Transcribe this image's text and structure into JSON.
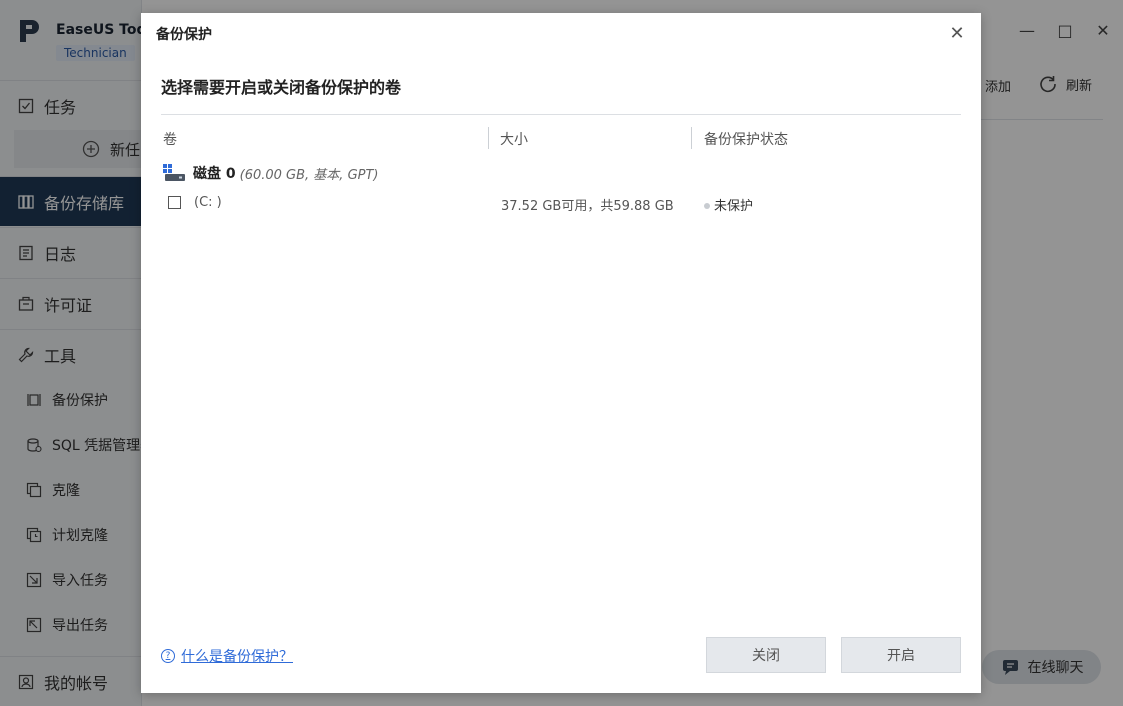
{
  "app": {
    "name": "EaseUS Todo",
    "edition": "Technician"
  },
  "sidebar": {
    "items": [
      {
        "label": "任务"
      },
      {
        "label": "新任"
      },
      {
        "label": "备份存储库"
      },
      {
        "label": "日志"
      },
      {
        "label": "许可证"
      },
      {
        "label": "工具"
      }
    ],
    "tools": [
      {
        "label": "备份保护"
      },
      {
        "label": "SQL 凭据管理器"
      },
      {
        "label": "克隆"
      },
      {
        "label": "计划克隆"
      },
      {
        "label": "导入任务"
      },
      {
        "label": "导出任务"
      }
    ],
    "account": {
      "label": "我的帐号"
    }
  },
  "toolbar": {
    "add_label": "添加",
    "refresh_label": "刷新"
  },
  "chat": {
    "label": "在线聊天"
  },
  "dialog": {
    "title": "备份保护",
    "subtitle": "选择需要开启或关闭备份保护的卷",
    "columns": [
      "卷",
      "大小",
      "备份保护状态"
    ],
    "disk": {
      "name": "磁盘 0",
      "detail": "(60.00 GB, 基本, GPT)"
    },
    "volumes": [
      {
        "name": "(C: )",
        "size": "37.52 GB可用，共59.88 GB",
        "status": "未保护",
        "checked": false
      }
    ],
    "help_link": "什么是备份保护？",
    "close_button": "关闭",
    "enable_button": "开启"
  }
}
